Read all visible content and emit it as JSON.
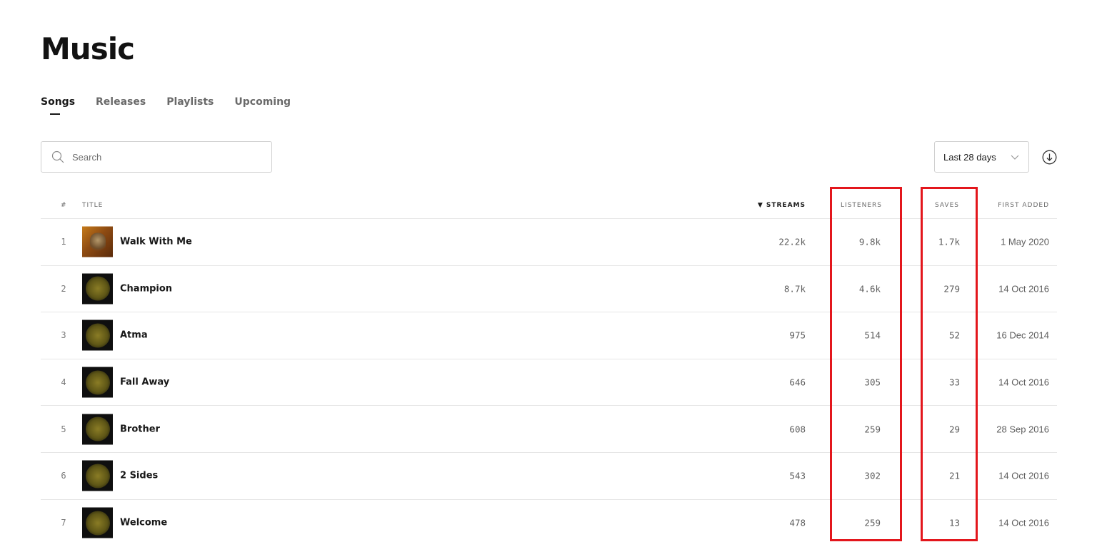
{
  "page_title": "Music",
  "tabs": [
    {
      "label": "Songs",
      "active": true
    },
    {
      "label": "Releases",
      "active": false
    },
    {
      "label": "Playlists",
      "active": false
    },
    {
      "label": "Upcoming",
      "active": false
    }
  ],
  "search": {
    "placeholder": "Search",
    "value": ""
  },
  "date_range": {
    "selected": "Last 28 days"
  },
  "table": {
    "headers": {
      "index": "#",
      "title": "TITLE",
      "streams": "▼ STREAMS",
      "listeners": "LISTENERS",
      "saves": "SAVES",
      "first_added": "FIRST ADDED"
    },
    "sorted_column": "streams",
    "rows": [
      {
        "index": "1",
        "title": "Walk With Me",
        "streams": "22.2k",
        "listeners": "9.8k",
        "saves": "1.7k",
        "first_added": "1 May 2020"
      },
      {
        "index": "2",
        "title": "Champion",
        "streams": "8.7k",
        "listeners": "4.6k",
        "saves": "279",
        "first_added": "14 Oct 2016"
      },
      {
        "index": "3",
        "title": "Atma",
        "streams": "975",
        "listeners": "514",
        "saves": "52",
        "first_added": "16 Dec 2014"
      },
      {
        "index": "4",
        "title": "Fall Away",
        "streams": "646",
        "listeners": "305",
        "saves": "33",
        "first_added": "14 Oct 2016"
      },
      {
        "index": "5",
        "title": "Brother",
        "streams": "608",
        "listeners": "259",
        "saves": "29",
        "first_added": "28 Sep 2016"
      },
      {
        "index": "6",
        "title": "2 Sides",
        "streams": "543",
        "listeners": "302",
        "saves": "21",
        "first_added": "14 Oct 2016"
      },
      {
        "index": "7",
        "title": "Welcome",
        "streams": "478",
        "listeners": "259",
        "saves": "13",
        "first_added": "14 Oct 2016"
      }
    ]
  },
  "annotation_color": "#e3161c"
}
